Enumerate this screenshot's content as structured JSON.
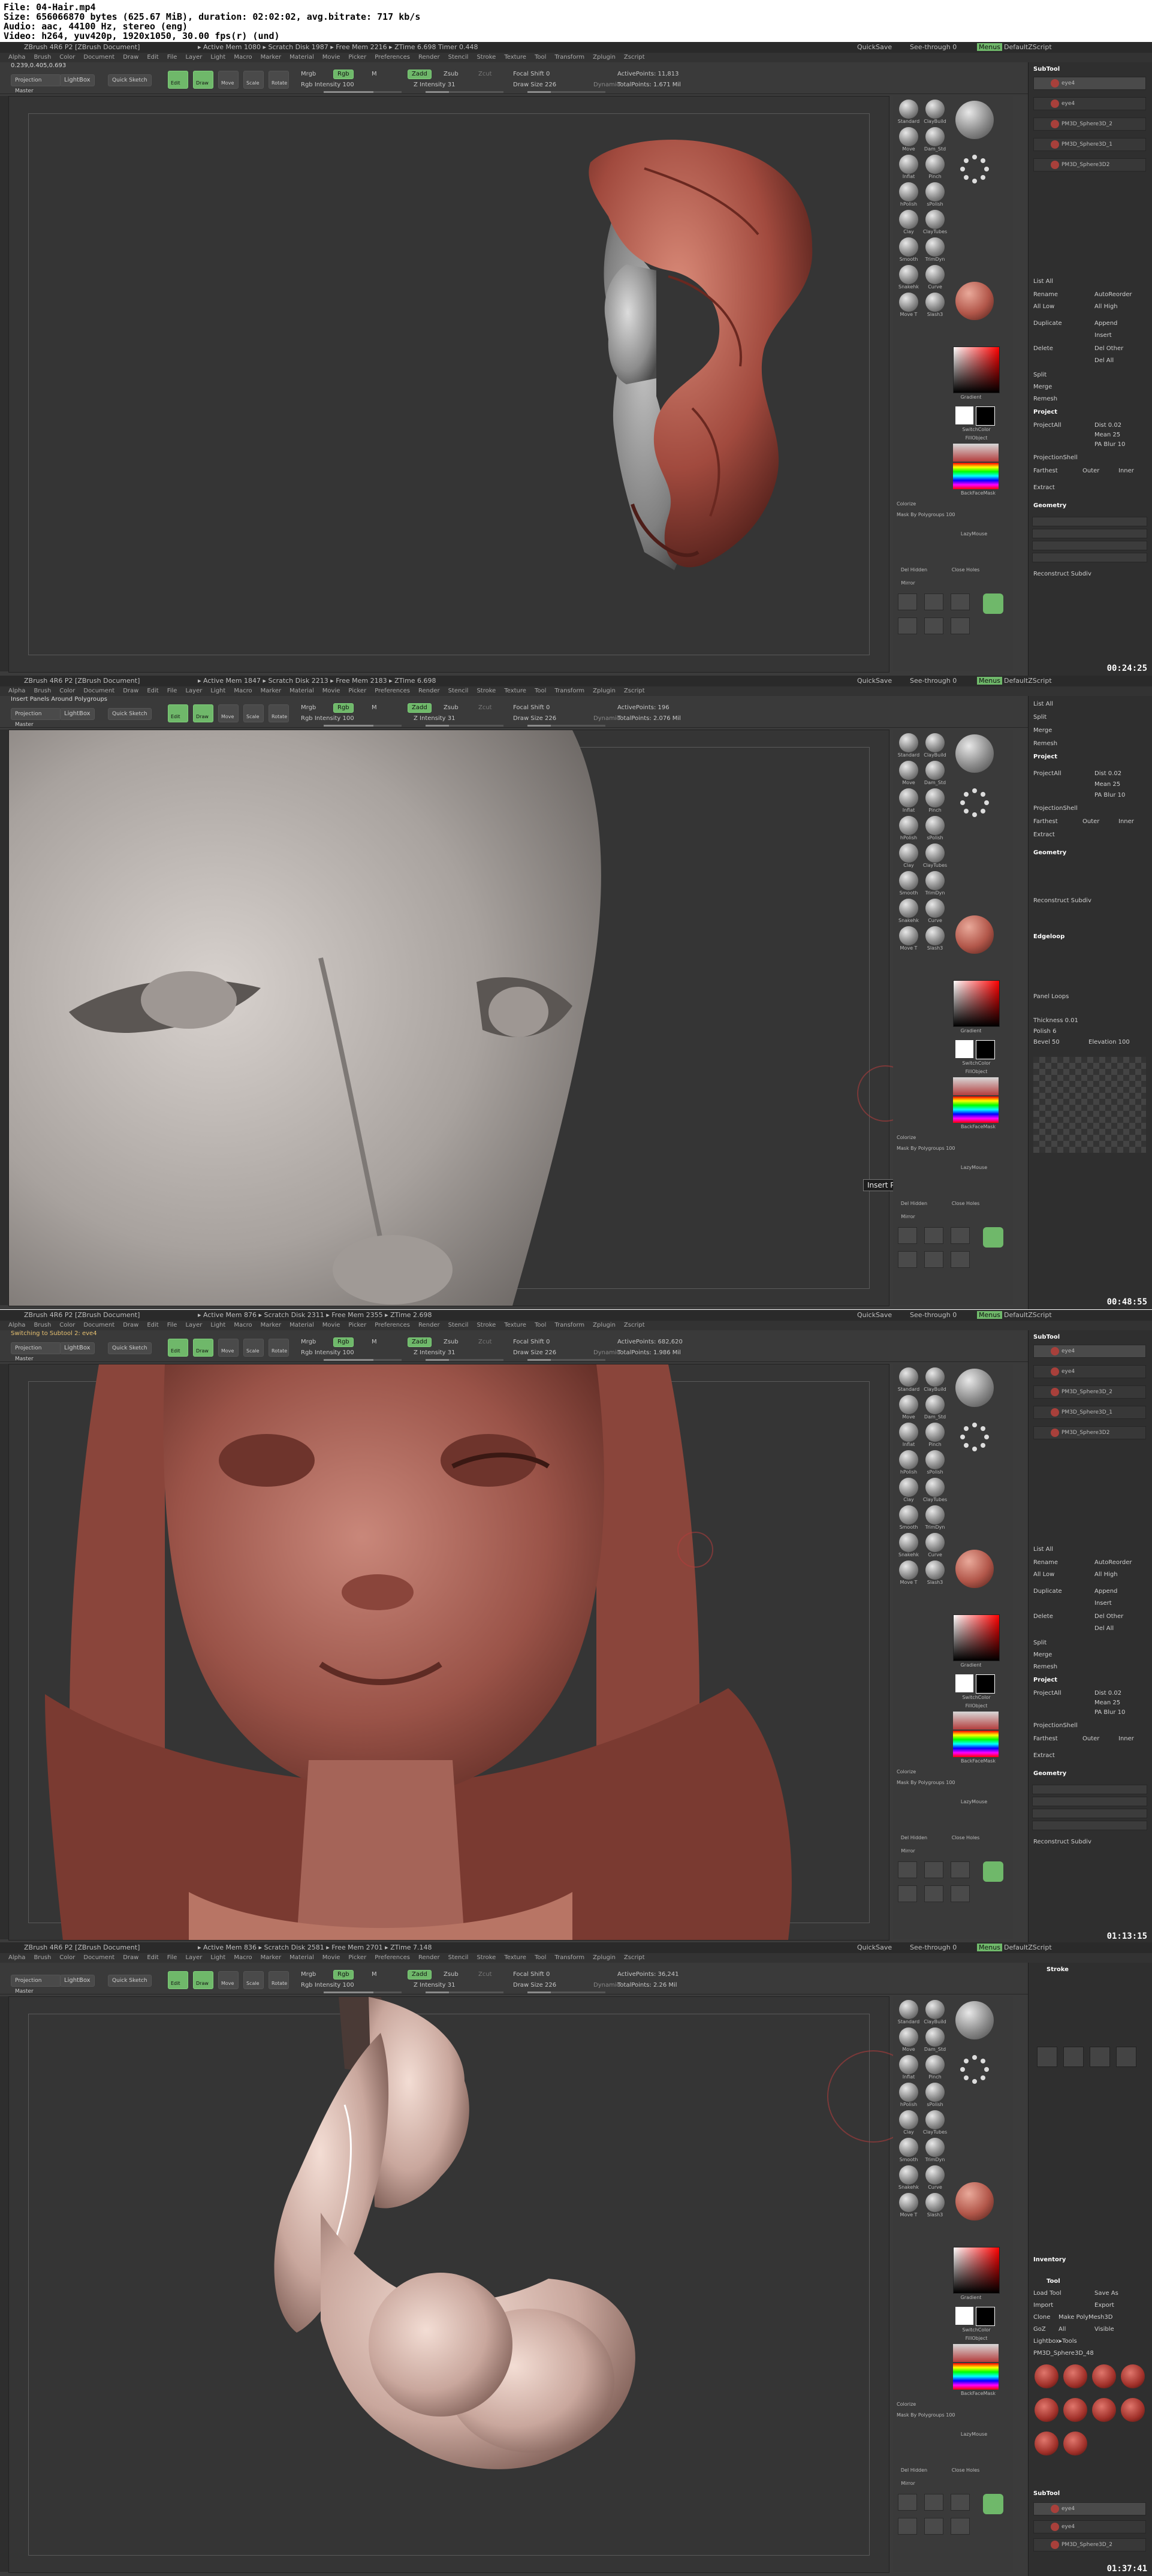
{
  "header": {
    "file": "File: 04-Hair.mp4",
    "size": "Size: 656066870 bytes (625.67 MiB), duration: 02:02:02, avg.bitrate: 717 kb/s",
    "audio": "Audio: aac, 44100 Hz, stereo (eng)",
    "video": "Video: h264, yuv420p, 1920x1050, 30.00 fps(r) (und)"
  },
  "frames": [
    {
      "title": "ZBrush 4R6 P2 [ZBrush Document]",
      "stats": "▸ Active Mem 1080 ▸ Scratch Disk 1987 ▸ Free Mem 2216 ▸ ZTime 6.698 Timer 0.448",
      "coords": "0.239,0.405,0.693",
      "active_points": "ActivePoints: 11,813",
      "total_points": "TotalPoints: 1.671 Mil",
      "timestamp": "00:24:25",
      "status_text": "",
      "tooltip": "",
      "variant": "hair"
    },
    {
      "title": "ZBrush 4R6 P2 [ZBrush Document]",
      "stats": "▸ Active Mem 1847 ▸ Scratch Disk 2213 ▸ Free Mem 2183 ▸ ZTime 6.698",
      "coords": "Insert Panels Around Polygroups",
      "active_points": "ActivePoints: 196",
      "total_points": "TotalPoints: 2.076 Mil",
      "timestamp": "00:48:55",
      "status_text": "",
      "tooltip": "Insert Panels Around Polygroups",
      "variant": "face"
    },
    {
      "title": "ZBrush 4R6 P2 [ZBrush Document]",
      "stats": "▸ Active Mem 876 ▸ Scratch Disk 2311 ▸ Free Mem 2355 ▸ ZTime 2.698",
      "coords": "Switching to Subtool 2: eve4",
      "active_points": "ActivePoints: 682,620",
      "total_points": "TotalPoints: 1.986 Mil",
      "timestamp": "01:13:15",
      "status_text": "Switching to Subtool 2:  eve4",
      "tooltip": "",
      "variant": "bust"
    },
    {
      "title": "ZBrush 4R6 P2 [ZBrush Document]",
      "stats": "▸ Active Mem 836 ▸ Scratch Disk 2581 ▸ Free Mem 2701 ▸ ZTime 7.148",
      "coords": "",
      "active_points": "ActivePoints: 36,241",
      "total_points": "TotalPoints: 2.26 Mil",
      "timestamp": "01:37:41",
      "status_text": "",
      "tooltip": "",
      "variant": "side"
    }
  ],
  "menu": [
    "Alpha",
    "Brush",
    "Color",
    "Document",
    "Draw",
    "Edit",
    "File",
    "Layer",
    "Light",
    "Macro",
    "Marker",
    "Material",
    "Movie",
    "Picker",
    "Preferences",
    "Render",
    "Stencil",
    "Stroke",
    "Texture",
    "Tool",
    "Transform",
    "Zplugin",
    "Zscript"
  ],
  "toolbar": {
    "projection_master": "Projection Master",
    "lightbox": "LightBox",
    "quick_sketch": "Quick Sketch",
    "edit": "Edit",
    "draw": "Draw",
    "move": "Move",
    "scale": "Scale",
    "rotate": "Rotate",
    "mrgb": "Mrgb",
    "rgb": "Rgb",
    "m": "M",
    "zadd": "Zadd",
    "zsub": "Zsub",
    "zcut": "Zcut",
    "rgb_intensity": "Rgb Intensity 100",
    "z_intensity": "Z Intensity 31",
    "focal_shift": "Focal Shift 0",
    "draw_size": "Draw Size 226",
    "dynamic": "Dynamic",
    "quicksave": "QuickSave",
    "see_through": "See-through 0",
    "menus": "Menus",
    "default_script": "DefaultZScript"
  },
  "shelf": {
    "brushes": [
      "Standard",
      "ClayBuild",
      "Move",
      "Dam_Std",
      "Inflat",
      "Pinch",
      "hPolish",
      "sPolish",
      "Clay",
      "ClayTubes",
      "Smooth",
      "TrimDyn",
      "Snakehk",
      "Curve",
      "Move T",
      "Slash3"
    ],
    "gradient": "Gradient",
    "switch_color": "SwitchColor",
    "fill_object": "FillObject",
    "back_face_mask": "BackFaceMask",
    "colorize": "Colorize",
    "mask_by_polygroups": "Mask By Polygroups 100",
    "lazy_mouse": "LazyMouse",
    "del_hidden": "Del Hidden",
    "close_holes": "Close Holes",
    "mirror": "Mirror"
  },
  "panel": {
    "subtool": "SubTool",
    "subtools": [
      "eye4",
      "eye4",
      "PM3D_Sphere3D_2",
      "PM3D_Sphere3D_1",
      "PM3D_Sphere3D2"
    ],
    "list_all": "List All",
    "rename": "Rename",
    "auto_reorder": "AutoReorder",
    "all_low": "All Low",
    "all_high": "All High",
    "duplicate": "Duplicate",
    "append": "Append",
    "insert": "Insert",
    "delete": "Delete",
    "del_other": "Del Other",
    "del_all": "Del All",
    "split": "Split",
    "merge": "Merge",
    "remesh": "Remesh",
    "project": "Project",
    "project_all": "ProjectAll",
    "dist": "Dist 0.02",
    "mean": "Mean 25",
    "pa_blur": "PA Blur 10",
    "project_shell": "ProjectionShell",
    "farthest": "Farthest",
    "outer": "Outer",
    "inner": "Inner",
    "extract": "Extract",
    "geometry": "Geometry",
    "reconstruct": "Reconstruct Subdiv",
    "edgeloop": "Edgeloop",
    "panel_loops": "Panel Loops",
    "thickness": "Thickness 0.01",
    "polish": "Polish 6",
    "bevel": "Bevel 50",
    "elevation": "Elevation 100",
    "stroke": "Stroke",
    "tool": "Tool",
    "inventory": "Inventory",
    "load_tool": "Load Tool",
    "save_as": "Save As",
    "import": "Import",
    "export": "Export",
    "clone": "Clone",
    "make_polymesh": "Make PolyMesh3D",
    "goz": "GoZ",
    "all": "All",
    "visible": "Visible",
    "lightbox_tools": "Lightbox▸Tools",
    "current_tool": "PM3D_Sphere3D_48"
  },
  "colors": {
    "bg": "#3b3b3b",
    "accent": "#6fb86a",
    "clay": "#b2574a",
    "grey_mat": "#a7a7a7"
  }
}
